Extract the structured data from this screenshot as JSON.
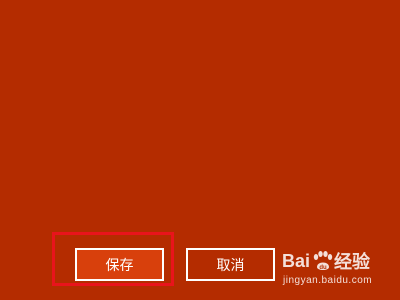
{
  "dialog": {
    "background_color": "#b42c00",
    "buttons": {
      "save_label": "保存",
      "cancel_label": "取消",
      "save_color": "#d8400c",
      "highlight_color": "#e8141c"
    }
  },
  "watermark": {
    "logo_text_left": "Bai",
    "logo_text_right": "经验",
    "logo_icon": "paw-icon",
    "url": "jingyan.baidu.com"
  }
}
